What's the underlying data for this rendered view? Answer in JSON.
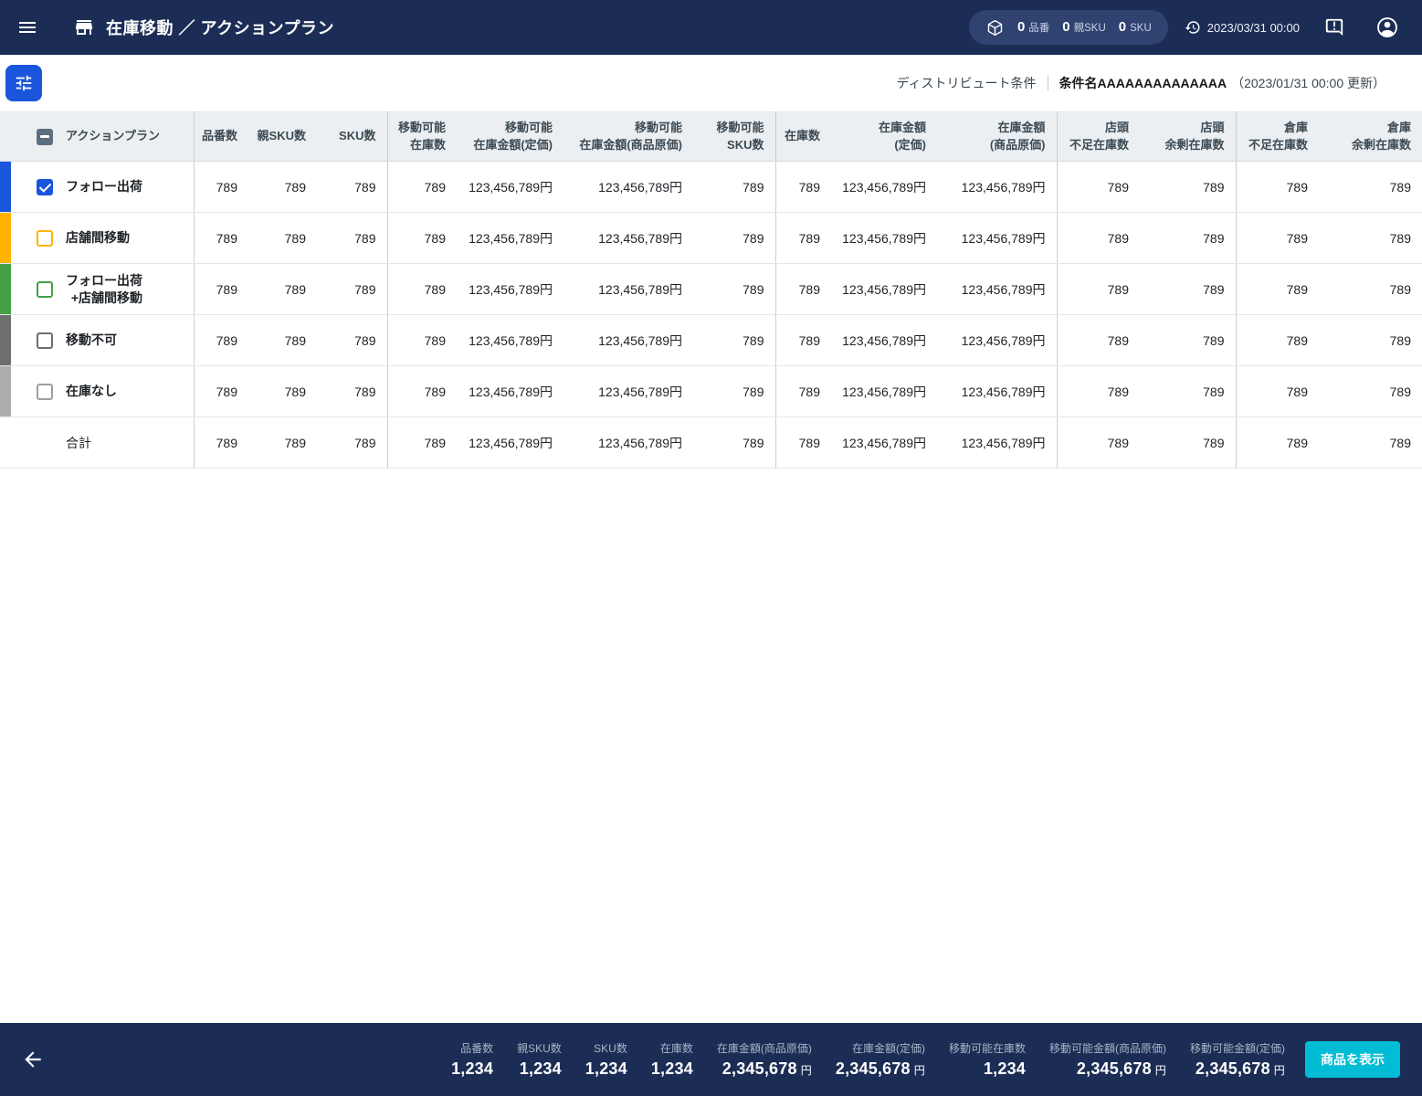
{
  "app": {
    "title": "在庫移動 ／ アクションプラン",
    "timestamp": "2023/03/31 00:00",
    "counters": [
      {
        "value": "0",
        "label": "品番"
      },
      {
        "value": "0",
        "label": "親SKU"
      },
      {
        "value": "0",
        "label": "SKU"
      }
    ]
  },
  "toolbar": {
    "condition_label": "ディストリビュート条件",
    "condition_name": "条件名AAAAAAAAAAAAAA",
    "condition_updated": "（2023/01/31 00:00 更新）"
  },
  "colors": {
    "navy": "#1C2D55",
    "accent_blue": "#1A56DB",
    "amber": "#FFB300",
    "green": "#43A047",
    "dark_gray": "#6E6E6E",
    "light_gray": "#ACACAC",
    "cyan_button": "#00BCD4",
    "header_checkbox": "#5C6F80"
  },
  "table": {
    "header_checkbox_state": "indeterminate",
    "header_checkbox_color": "#5C6F80",
    "columns": [
      {
        "lines": [
          "アクションプラン"
        ]
      },
      {
        "lines": [
          "品番数"
        ]
      },
      {
        "lines": [
          "親SKU数"
        ]
      },
      {
        "lines": [
          "SKU数"
        ]
      },
      {
        "lines": [
          "移動可能",
          "在庫数"
        ]
      },
      {
        "lines": [
          "移動可能",
          "在庫金額(定価)"
        ]
      },
      {
        "lines": [
          "移動可能",
          "在庫金額(商品原価)"
        ]
      },
      {
        "lines": [
          "移動可能",
          "SKU数"
        ]
      },
      {
        "lines": [
          "在庫数"
        ]
      },
      {
        "lines": [
          "在庫金額",
          "(定価)"
        ]
      },
      {
        "lines": [
          "在庫金額",
          "(商品原価)"
        ]
      },
      {
        "lines": [
          "店頭",
          "不足在庫数"
        ]
      },
      {
        "lines": [
          "店頭",
          "余剰在庫数"
        ]
      },
      {
        "lines": [
          "倉庫",
          "不足在庫数"
        ]
      },
      {
        "lines": [
          "倉庫",
          "余剰在庫数"
        ]
      }
    ],
    "rows": [
      {
        "label_lines": [
          "フォロー出荷"
        ],
        "bar_color": "#1A56DB",
        "checkbox": {
          "state": "checked",
          "color": "#1A56DB"
        },
        "values": [
          "789",
          "789",
          "789",
          "789",
          "123,456,789円",
          "123,456,789円",
          "789",
          "789",
          "123,456,789円",
          "123,456,789円",
          "789",
          "789",
          "789",
          "789"
        ]
      },
      {
        "label_lines": [
          "店舗間移動"
        ],
        "bar_color": "#FFB300",
        "checkbox": {
          "state": "unchecked",
          "color": "#FFB300"
        },
        "values": [
          "789",
          "789",
          "789",
          "789",
          "123,456,789円",
          "123,456,789円",
          "789",
          "789",
          "123,456,789円",
          "123,456,789円",
          "789",
          "789",
          "789",
          "789"
        ]
      },
      {
        "label_lines": [
          "フォロー出荷",
          "+店舗間移動"
        ],
        "bar_color": "#43A047",
        "checkbox": {
          "state": "unchecked",
          "color": "#43A047"
        },
        "values": [
          "789",
          "789",
          "789",
          "789",
          "123,456,789円",
          "123,456,789円",
          "789",
          "789",
          "123,456,789円",
          "123,456,789円",
          "789",
          "789",
          "789",
          "789"
        ]
      },
      {
        "label_lines": [
          "移動不可"
        ],
        "bar_color": "#6E6E6E",
        "checkbox": {
          "state": "unchecked",
          "color": "#6E6E6E"
        },
        "values": [
          "789",
          "789",
          "789",
          "789",
          "123,456,789円",
          "123,456,789円",
          "789",
          "789",
          "123,456,789円",
          "123,456,789円",
          "789",
          "789",
          "789",
          "789"
        ]
      },
      {
        "label_lines": [
          "在庫なし"
        ],
        "bar_color": "#ACACAC",
        "checkbox": {
          "state": "unchecked",
          "color": "#9E9E9E"
        },
        "values": [
          "789",
          "789",
          "789",
          "789",
          "123,456,789円",
          "123,456,789円",
          "789",
          "789",
          "123,456,789円",
          "123,456,789円",
          "789",
          "789",
          "789",
          "789"
        ]
      }
    ],
    "total_row": {
      "label": "合計",
      "values": [
        "789",
        "789",
        "789",
        "789",
        "123,456,789円",
        "123,456,789円",
        "789",
        "789",
        "123,456,789円",
        "123,456,789円",
        "789",
        "789",
        "789",
        "789"
      ]
    }
  },
  "footer": {
    "stats": [
      {
        "label": "品番数",
        "value": "1,234",
        "unit": ""
      },
      {
        "label": "親SKU数",
        "value": "1,234",
        "unit": ""
      },
      {
        "label": "SKU数",
        "value": "1,234",
        "unit": ""
      },
      {
        "label": "在庫数",
        "value": "1,234",
        "unit": ""
      },
      {
        "label": "在庫金額(商品原価)",
        "value": "2,345,678",
        "unit": "円"
      },
      {
        "label": "在庫金額(定価)",
        "value": "2,345,678",
        "unit": "円"
      },
      {
        "label": "移動可能在庫数",
        "value": "1,234",
        "unit": ""
      },
      {
        "label": "移動可能金額(商品原価)",
        "value": "2,345,678",
        "unit": "円"
      },
      {
        "label": "移動可能金額(定価)",
        "value": "2,345,678",
        "unit": "円"
      }
    ],
    "show_products_button": "商品を表示"
  }
}
